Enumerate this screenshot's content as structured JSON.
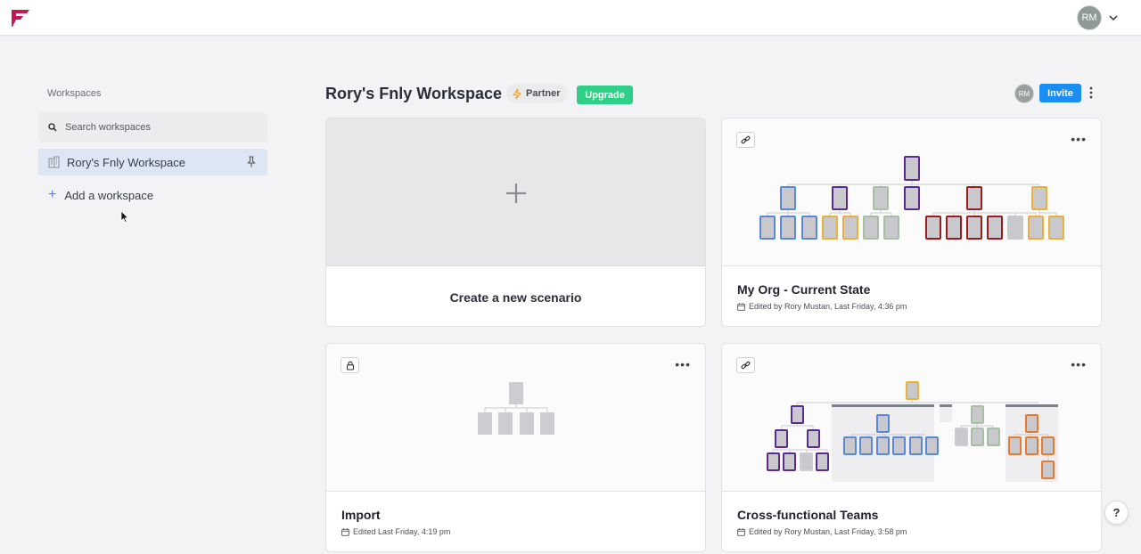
{
  "topbar": {
    "logo": "fnly-logo",
    "user_initials": "RM",
    "brand_color": "#c8164f"
  },
  "sidebar": {
    "title": "Workspaces",
    "search_placeholder": "Search workspaces",
    "workspaces": [
      {
        "label": "Rory's Fnly Workspace",
        "selected": true,
        "pinned": true
      }
    ],
    "add_label": "Add a workspace"
  },
  "workspace": {
    "title": "Rory's Fnly Workspace",
    "plan_badge": "Partner",
    "upgrade_label": "Upgrade",
    "member_initials": "RM",
    "invite_label": "Invite",
    "upgrade_color": "#2ecf86",
    "invite_color": "#1a8df2"
  },
  "cards": [
    {
      "type": "new",
      "title": "Create a new scenario"
    },
    {
      "type": "scenario",
      "title": "My Org - Current State",
      "subtitle": "Edited by Rory Mustan, Last Friday, 4:36 pm",
      "icon": "link-icon"
    },
    {
      "type": "scenario",
      "title": "Import",
      "subtitle": "Edited Last Friday, 4:19 pm",
      "icon": "lock-icon"
    },
    {
      "type": "scenario",
      "title": "Cross-functional Teams",
      "subtitle": "Edited by Rory Mustan, Last Friday, 3:58 pm",
      "icon": "link-icon"
    }
  ],
  "help_label": "?"
}
